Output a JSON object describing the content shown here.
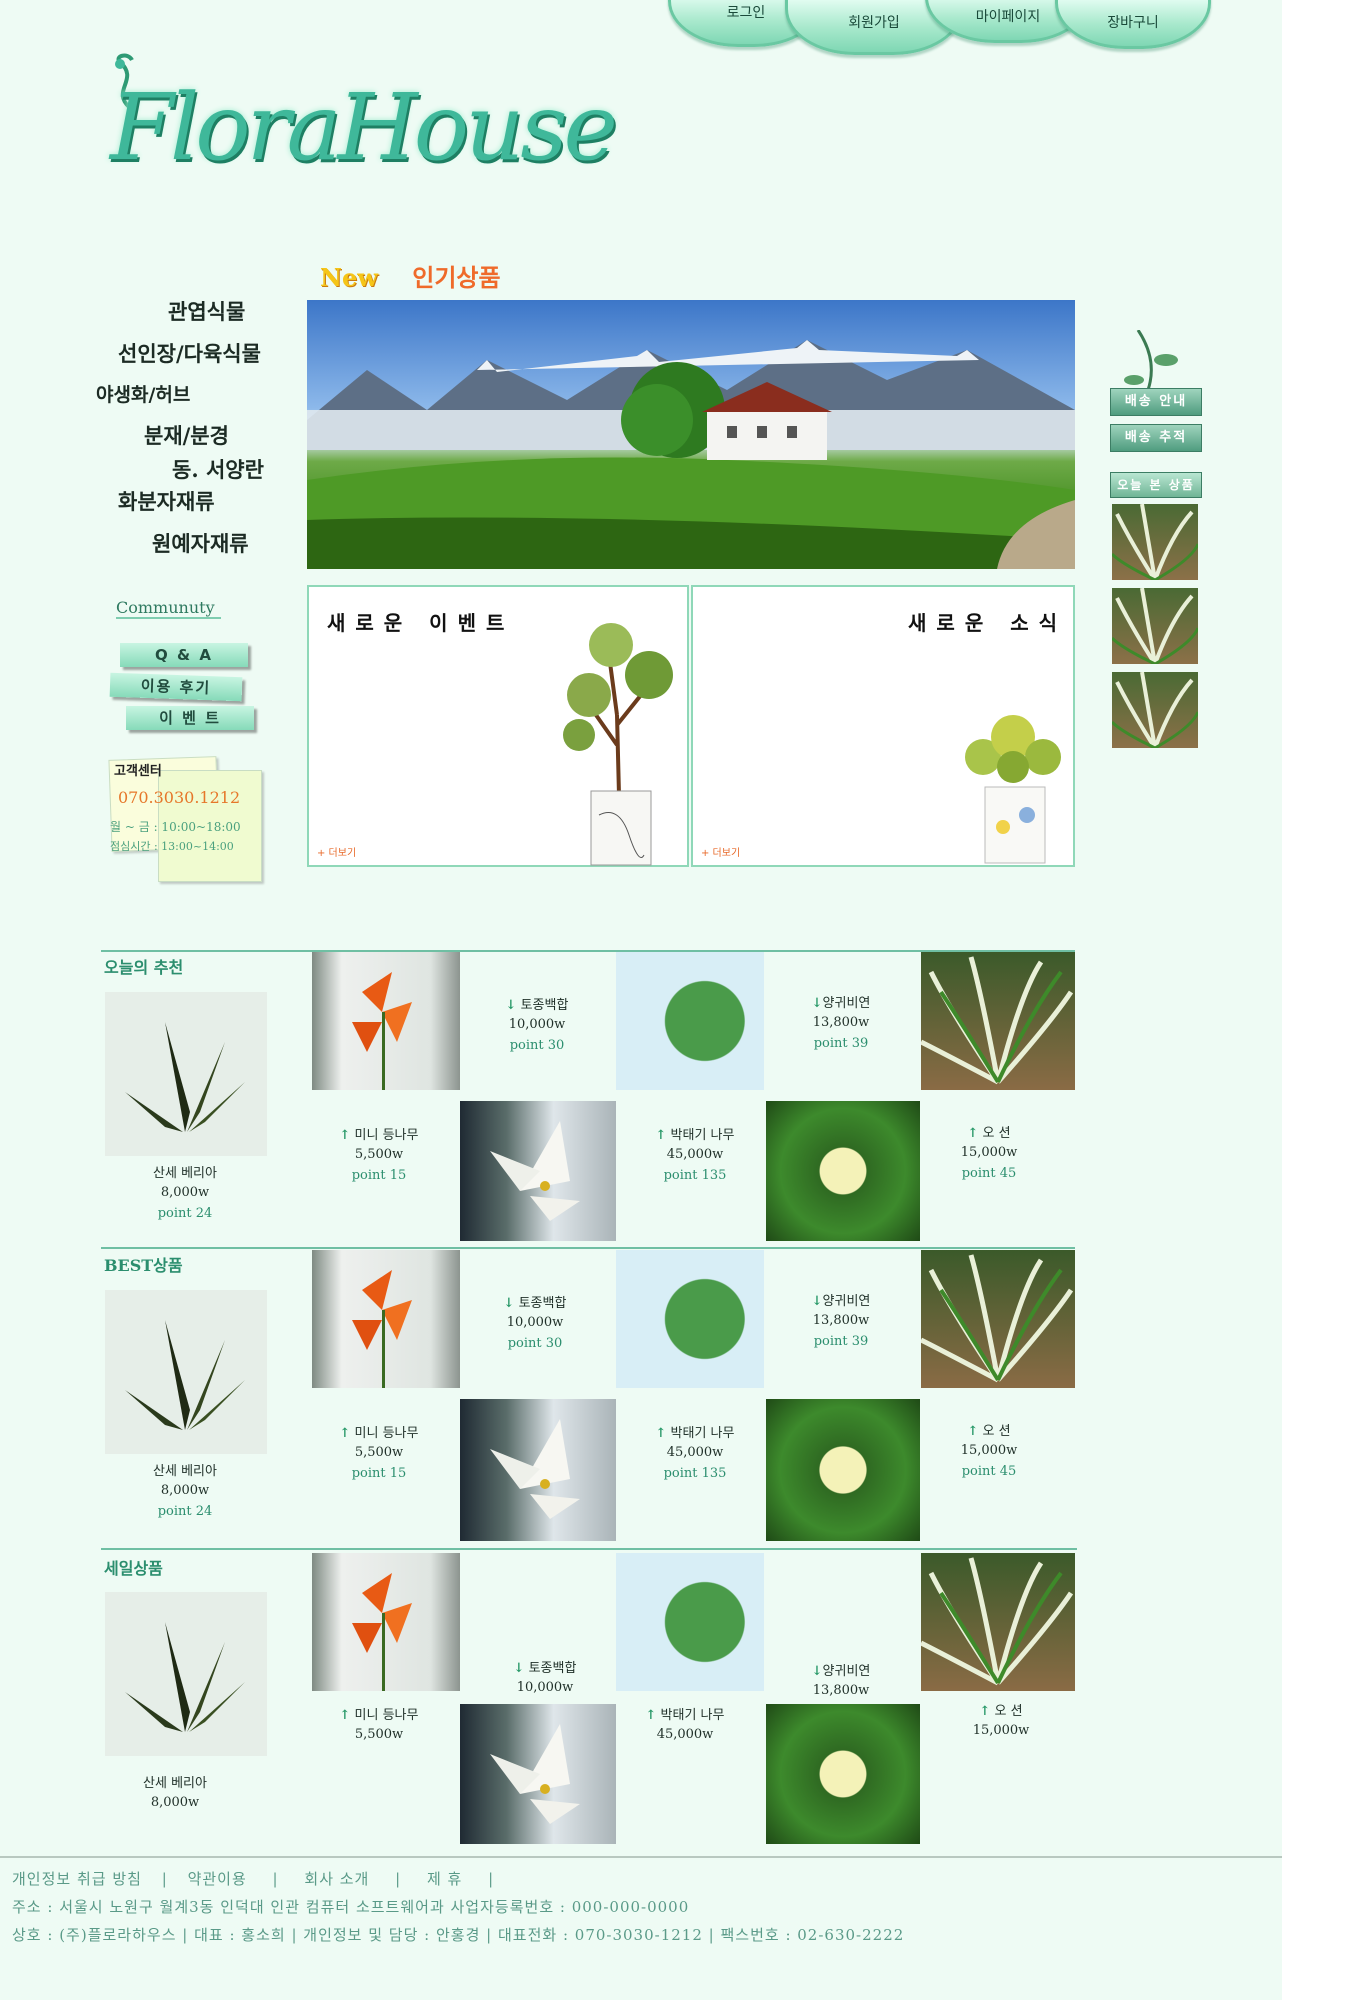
{
  "nav": {
    "login": "로그인",
    "join": "회원가입",
    "mypage": "마이페이지",
    "cart": "장바구니"
  },
  "logo": {
    "text": "FloraHouse"
  },
  "popular_title": {
    "new": "New",
    "label": "인기상품"
  },
  "categories": [
    "관엽식물",
    "선인장/다육식물",
    "야생화/허브",
    "분재/분경",
    "동. 서양란",
    "화분자재류",
    "원예자재류"
  ],
  "community": {
    "title": "Communuty",
    "items": [
      "Q & A",
      "이용 후기",
      "이 벤 트"
    ]
  },
  "customer_center": {
    "title": "고객센터",
    "phone": "070.3030.1212",
    "hours_label": "월 ~ 금 : 10:00~18:00",
    "lunch_label": "점심시간 : 13:00~14:00"
  },
  "event_box": {
    "title": "새로운 이벤트",
    "more": "+ 더보기"
  },
  "news_box": {
    "title": "새로운 소식",
    "more": "+ 더보기"
  },
  "sections": [
    {
      "title": "오늘의 추천",
      "featured": {
        "name": "산세 베리아",
        "price": "8,000w",
        "point": "point 24"
      },
      "top": [
        {
          "arrow": "↓",
          "name": "토종백합",
          "price": "10,000w",
          "point": "point 30"
        },
        {
          "arrow": "↓",
          "name": "양귀비연",
          "price": "13,800w",
          "point": "point 39"
        }
      ],
      "bottom": [
        {
          "arrow": "↑",
          "name": "미니 등나무",
          "price": "5,500w",
          "point": "point 15"
        },
        {
          "arrow": "↑",
          "name": "박태기 나무",
          "price": "45,000w",
          "point": "point 135"
        },
        {
          "arrow": "↑",
          "name": "오 션",
          "price": "15,000w",
          "point": "point 45"
        }
      ]
    },
    {
      "title": "BEST상품",
      "featured": {
        "name": "산세 베리아",
        "price": "8,000w",
        "point": "point 24"
      },
      "top": [
        {
          "arrow": "↓",
          "name": "토종백합",
          "price": "10,000w",
          "point": "point 30"
        },
        {
          "arrow": "↓",
          "name": "양귀비연",
          "price": "13,800w",
          "point": "point 39"
        }
      ],
      "bottom": [
        {
          "arrow": "↑",
          "name": "미니 등나무",
          "price": "5,500w",
          "point": "point 15"
        },
        {
          "arrow": "↑",
          "name": "박태기 나무",
          "price": "45,000w",
          "point": "point 135"
        },
        {
          "arrow": "↑",
          "name": "오 션",
          "price": "15,000w",
          "point": "point 45"
        }
      ]
    },
    {
      "title": "세일상품",
      "featured": {
        "name": "산세 베리아",
        "price": "8,000w"
      },
      "top": [
        {
          "arrow": "↓",
          "name": "토종백합",
          "price": "10,000w"
        },
        {
          "arrow": "↓",
          "name": "양귀비연",
          "price": "13,800w"
        }
      ],
      "bottom": [
        {
          "arrow": "↑",
          "name": "미니 등나무",
          "price": "5,500w"
        },
        {
          "arrow": "↑",
          "name": "박태기 나무",
          "price": "45,000w"
        },
        {
          "arrow": "↑",
          "name": "오 션",
          "price": "15,000w"
        }
      ]
    }
  ],
  "side": {
    "delivery_info": "배송 안내",
    "delivery_track": "배송 추적",
    "today_seen": "오늘 본 상품"
  },
  "footer": {
    "links": [
      "개인정보 취급 방침",
      "약관이용",
      "회사 소개",
      "제 휴"
    ],
    "address": "주소 : 서울시 노원구 월계3동 인덕대 인관 컴퓨터 소프트웨어과   사업자등록번호 : 000-000-0000",
    "company": "상호 : (주)플로라하우스 | 대표 : 홍소희 | 개인정보 및 담당 : 안홍경  |  대표전화 : 070-3030-1212  | 팩스번호 : 02-630-2222"
  }
}
